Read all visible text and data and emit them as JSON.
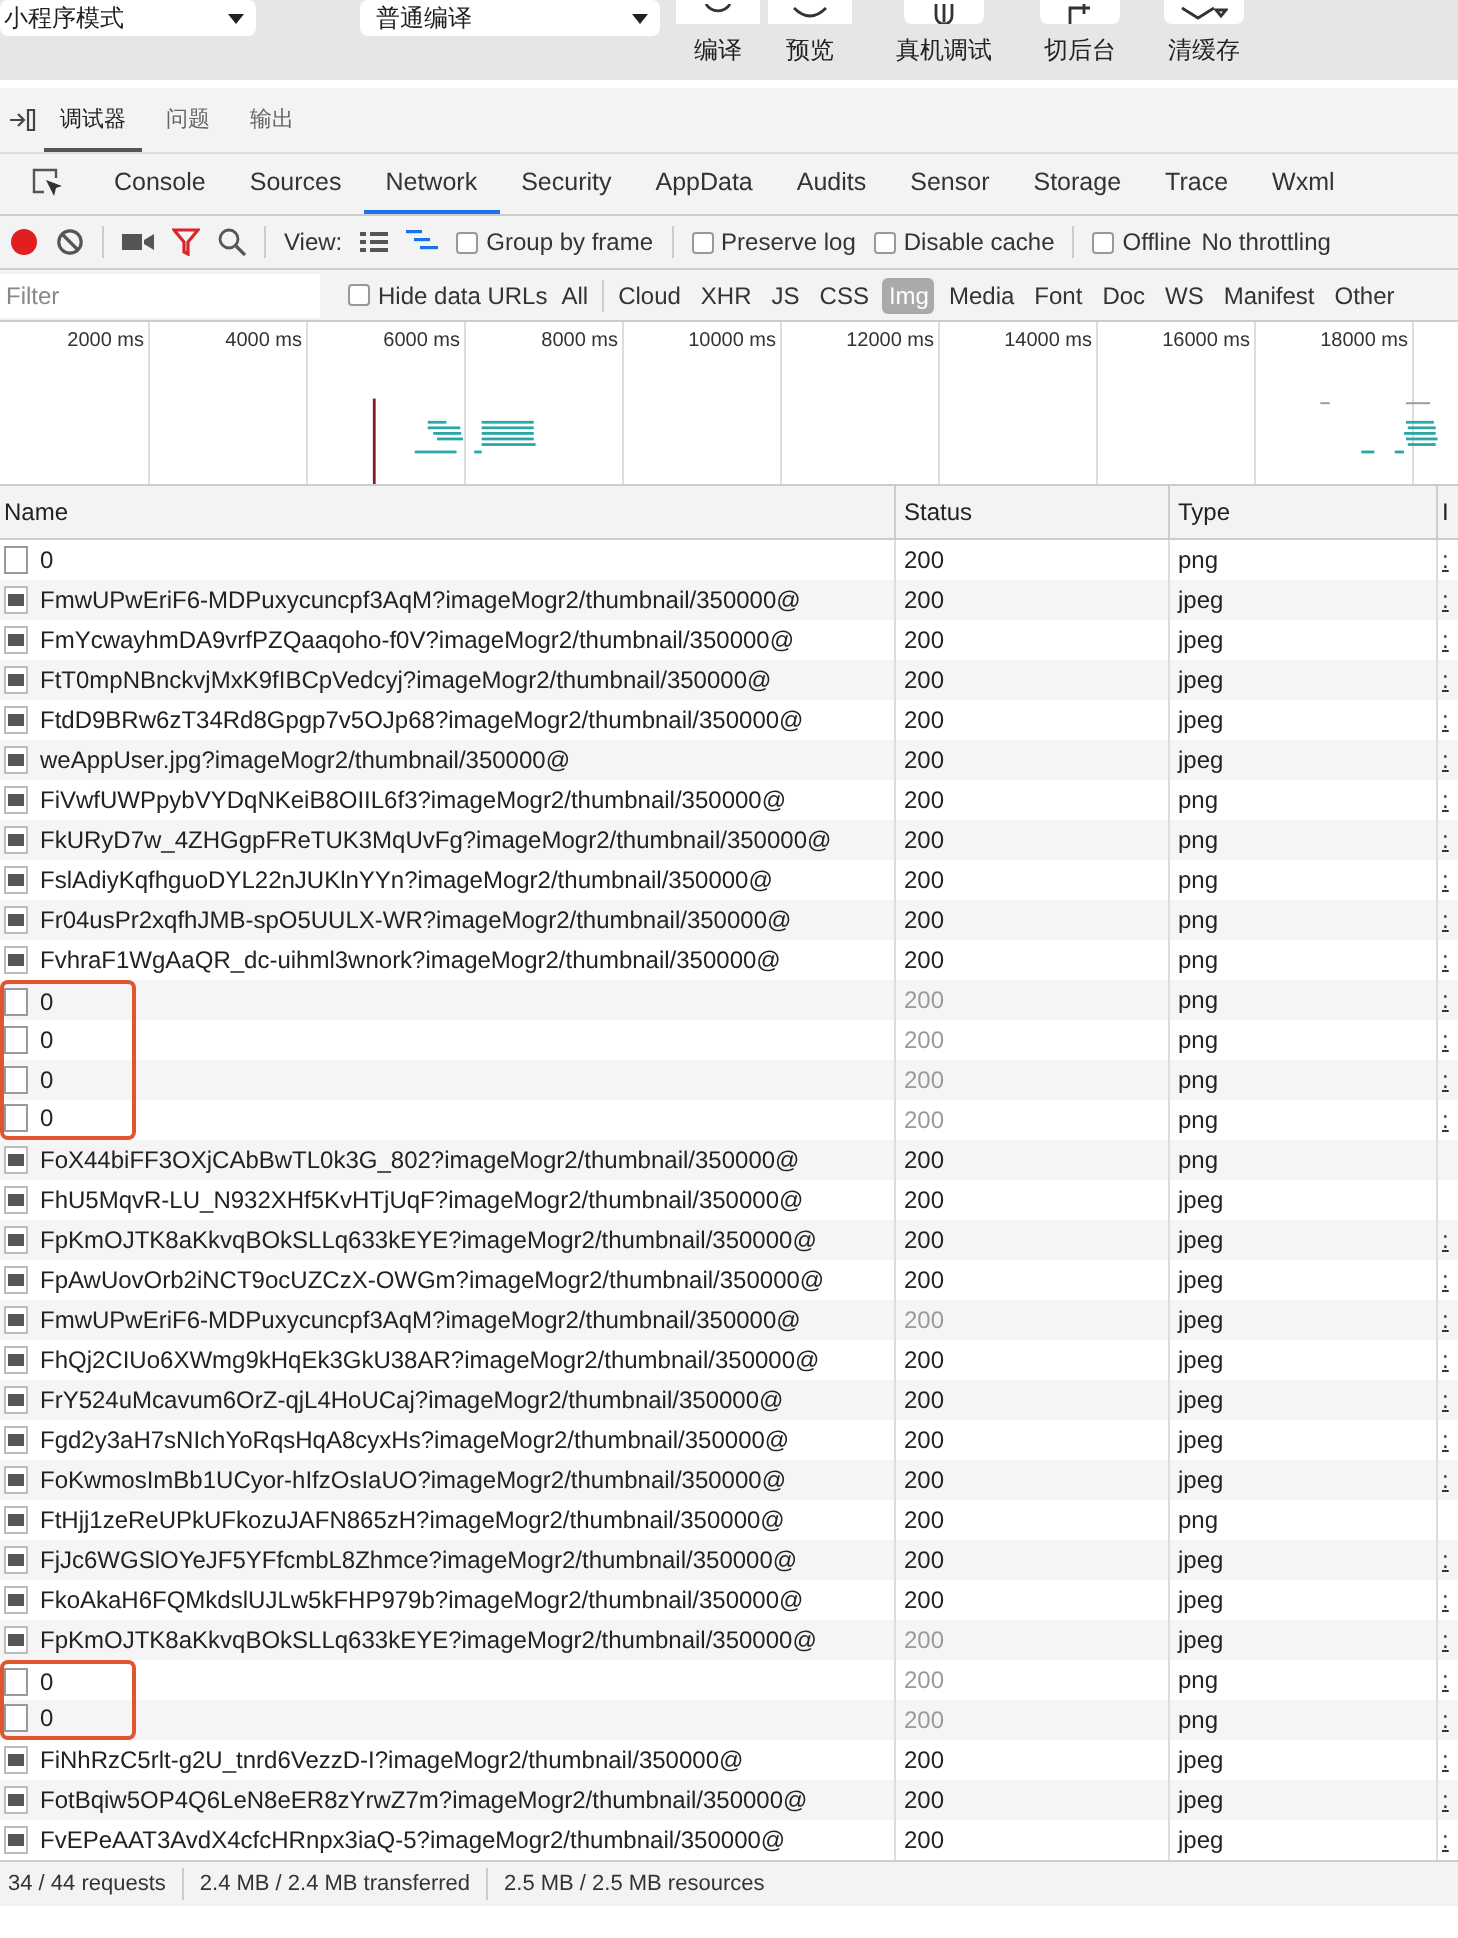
{
  "top_toolbar": {
    "mode_dropdown": "小程序模式",
    "compile_dropdown": "普通编译",
    "buttons": [
      {
        "label": "编译",
        "kind": "refresh"
      },
      {
        "label": "预览",
        "kind": "eye"
      },
      {
        "label": "真机调试",
        "kind": "bug"
      },
      {
        "label": "切后台",
        "kind": "switch"
      },
      {
        "label": "清缓存",
        "kind": "layers"
      }
    ]
  },
  "panel_tabs": [
    {
      "label": "调试器",
      "selected": true
    },
    {
      "label": "问题",
      "selected": false
    },
    {
      "label": "输出",
      "selected": false
    }
  ],
  "devtools_tabs": [
    {
      "label": "Console",
      "selected": false
    },
    {
      "label": "Sources",
      "selected": false
    },
    {
      "label": "Network",
      "selected": true
    },
    {
      "label": "Security",
      "selected": false
    },
    {
      "label": "AppData",
      "selected": false
    },
    {
      "label": "Audits",
      "selected": false
    },
    {
      "label": "Sensor",
      "selected": false
    },
    {
      "label": "Storage",
      "selected": false
    },
    {
      "label": "Trace",
      "selected": false
    },
    {
      "label": "Wxml",
      "selected": false
    }
  ],
  "network_toolbar": {
    "recording": true,
    "filter_active": true,
    "view_label": "View:",
    "large_rows": false,
    "waterfall_view": true,
    "checkboxes": [
      {
        "label": "Group by frame",
        "checked": false
      },
      {
        "label": "Preserve log",
        "checked": false
      },
      {
        "label": "Disable cache",
        "checked": false
      },
      {
        "label": "Offline",
        "checked": false
      }
    ],
    "throttling": "No throttling"
  },
  "filter_bar": {
    "placeholder": "Filter",
    "hide_data_urls": {
      "label": "Hide data URLs",
      "checked": false
    },
    "types": [
      {
        "label": "All",
        "selected": false
      },
      {
        "label": "Cloud",
        "selected": false
      },
      {
        "label": "XHR",
        "selected": false
      },
      {
        "label": "JS",
        "selected": false
      },
      {
        "label": "CSS",
        "selected": false
      },
      {
        "label": "Img",
        "selected": true
      },
      {
        "label": "Media",
        "selected": false
      },
      {
        "label": "Font",
        "selected": false
      },
      {
        "label": "Doc",
        "selected": false
      },
      {
        "label": "WS",
        "selected": false
      },
      {
        "label": "Manifest",
        "selected": false
      },
      {
        "label": "Other",
        "selected": false
      }
    ]
  },
  "timeline": {
    "ticks": [
      "2000 ms",
      "4000 ms",
      "6000 ms",
      "8000 ms",
      "10000 ms",
      "12000 ms",
      "14000 ms",
      "16000 ms",
      "18000 ms"
    ]
  },
  "table": {
    "columns": [
      "Name",
      "Status",
      "Type",
      "I"
    ],
    "rows": [
      {
        "name": "0",
        "status": "200",
        "type": "png",
        "column_4": ":",
        "kind": "blank",
        "dimmed": false,
        "highlighted": false
      },
      {
        "name": "FmwUPwEriF6-MDPuxycuncpf3AqM?imageMogr2/thumbnail/350000@",
        "status": "200",
        "type": "jpeg",
        "column_4": ":",
        "kind": "image",
        "dimmed": false,
        "highlighted": false
      },
      {
        "name": "FmYcwayhmDA9vrfPZQaaqoho-f0V?imageMogr2/thumbnail/350000@",
        "status": "200",
        "type": "jpeg",
        "column_4": ":",
        "kind": "image",
        "dimmed": false,
        "highlighted": false
      },
      {
        "name": "FtT0mpNBnckvjMxK9fIBCpVedcyj?imageMogr2/thumbnail/350000@",
        "status": "200",
        "type": "jpeg",
        "column_4": ":",
        "kind": "image",
        "dimmed": false,
        "highlighted": false
      },
      {
        "name": "FtdD9BRw6zT34Rd8Gpgp7v5OJp68?imageMogr2/thumbnail/350000@",
        "status": "200",
        "type": "jpeg",
        "column_4": ":",
        "kind": "image",
        "dimmed": false,
        "highlighted": false
      },
      {
        "name": "weAppUser.jpg?imageMogr2/thumbnail/350000@",
        "status": "200",
        "type": "jpeg",
        "column_4": ":",
        "kind": "image",
        "dimmed": false,
        "highlighted": false
      },
      {
        "name": "FiVwfUWPpybVYDqNKeiB8OIIL6f3?imageMogr2/thumbnail/350000@",
        "status": "200",
        "type": "png",
        "column_4": ":",
        "kind": "image",
        "dimmed": false,
        "highlighted": false
      },
      {
        "name": "FkURyD7w_4ZHGgpFReTUK3MqUvFg?imageMogr2/thumbnail/350000@",
        "status": "200",
        "type": "png",
        "column_4": ":",
        "kind": "image",
        "dimmed": false,
        "highlighted": false
      },
      {
        "name": "FslAdiyKqfhguoDYL22nJUKlnYYn?imageMogr2/thumbnail/350000@",
        "status": "200",
        "type": "png",
        "column_4": ":",
        "kind": "image",
        "dimmed": false,
        "highlighted": false
      },
      {
        "name": "Fr04usPr2xqfhJMB-spO5UULX-WR?imageMogr2/thumbnail/350000@",
        "status": "200",
        "type": "png",
        "column_4": ":",
        "kind": "image",
        "dimmed": false,
        "highlighted": false
      },
      {
        "name": "FvhraF1WgAaQR_dc-uihml3wnork?imageMogr2/thumbnail/350000@",
        "status": "200",
        "type": "png",
        "column_4": ":",
        "kind": "image",
        "dimmed": false,
        "highlighted": false
      },
      {
        "name": "0",
        "status": "200",
        "type": "png",
        "column_4": ":",
        "kind": "blank",
        "dimmed": true,
        "highlighted": true
      },
      {
        "name": "0",
        "status": "200",
        "type": "png",
        "column_4": ":",
        "kind": "blank",
        "dimmed": true,
        "highlighted": true
      },
      {
        "name": "0",
        "status": "200",
        "type": "png",
        "column_4": ":",
        "kind": "blank",
        "dimmed": true,
        "highlighted": true
      },
      {
        "name": "0",
        "status": "200",
        "type": "png",
        "column_4": ":",
        "kind": "blank",
        "dimmed": true,
        "highlighted": true
      },
      {
        "name": "FoX44biFF3OXjCAbBwTL0k3G_802?imageMogr2/thumbnail/350000@",
        "status": "200",
        "type": "png",
        "kind": "image",
        "dimmed": false,
        "highlighted": false
      },
      {
        "name": "FhU5MqvR-LU_N932XHf5KvHTjUqF?imageMogr2/thumbnail/350000@",
        "status": "200",
        "type": "jpeg",
        "kind": "image",
        "dimmed": false,
        "highlighted": false
      },
      {
        "name": "FpKmOJTK8aKkvqBOkSLLq633kEYE?imageMogr2/thumbnail/350000@",
        "status": "200",
        "type": "jpeg",
        "column_4": ":",
        "kind": "image",
        "dimmed": false,
        "highlighted": false
      },
      {
        "name": "FpAwUovOrb2iNCT9ocUZCzX-OWGm?imageMogr2/thumbnail/350000@",
        "status": "200",
        "type": "jpeg",
        "column_4": ":",
        "kind": "image",
        "dimmed": false,
        "highlighted": false
      },
      {
        "name": "FmwUPwEriF6-MDPuxycuncpf3AqM?imageMogr2/thumbnail/350000@",
        "status": "200",
        "type": "jpeg",
        "column_4": ":",
        "kind": "image",
        "dimmed": true,
        "highlighted": false
      },
      {
        "name": "FhQj2CIUo6XWmg9kHqEk3GkU38AR?imageMogr2/thumbnail/350000@",
        "status": "200",
        "type": "jpeg",
        "column_4": ":",
        "kind": "image",
        "dimmed": false,
        "highlighted": false
      },
      {
        "name": "FrY524uMcavum6OrZ-qjL4HoUCaj?imageMogr2/thumbnail/350000@",
        "status": "200",
        "type": "jpeg",
        "column_4": ":",
        "kind": "image",
        "dimmed": false,
        "highlighted": false
      },
      {
        "name": "Fgd2y3aH7sNIchYoRqsHqA8cyxHs?imageMogr2/thumbnail/350000@",
        "status": "200",
        "type": "jpeg",
        "column_4": ":",
        "kind": "image",
        "dimmed": false,
        "highlighted": false
      },
      {
        "name": "FoKwmosImBb1UCyor-hIfzOsIaUO?imageMogr2/thumbnail/350000@",
        "status": "200",
        "type": "jpeg",
        "column_4": ":",
        "kind": "image",
        "dimmed": false,
        "highlighted": false
      },
      {
        "name": "FtHjj1zeReUPkUFkozuJAFN865zH?imageMogr2/thumbnail/350000@",
        "status": "200",
        "type": "png",
        "kind": "image",
        "dimmed": false,
        "highlighted": false
      },
      {
        "name": "FjJc6WGSlOYeJF5YFfcmbL8Zhmce?imageMogr2/thumbnail/350000@",
        "status": "200",
        "type": "jpeg",
        "column_4": ":",
        "kind": "image",
        "dimmed": false,
        "highlighted": false
      },
      {
        "name": "FkoAkaH6FQMkdslUJLw5kFHP979b?imageMogr2/thumbnail/350000@",
        "status": "200",
        "type": "jpeg",
        "column_4": ":",
        "kind": "image",
        "dimmed": false,
        "highlighted": false
      },
      {
        "name": "FpKmOJTK8aKkvqBOkSLLq633kEYE?imageMogr2/thumbnail/350000@",
        "status": "200",
        "type": "jpeg",
        "column_4": ":",
        "kind": "image",
        "dimmed": true,
        "highlighted": false
      },
      {
        "name": "0",
        "status": "200",
        "type": "png",
        "column_4": ":",
        "kind": "blank",
        "dimmed": true,
        "highlighted": true
      },
      {
        "name": "0",
        "status": "200",
        "type": "png",
        "column_4": ":",
        "kind": "blank",
        "dimmed": true,
        "highlighted": true
      },
      {
        "name": "FiNhRzC5rlt-g2U_tnrd6VezzD-I?imageMogr2/thumbnail/350000@",
        "status": "200",
        "type": "jpeg",
        "column_4": ":",
        "kind": "image",
        "dimmed": false,
        "highlighted": false
      },
      {
        "name": "FotBqiw5OP4Q6LeN8eER8zYrwZ7m?imageMogr2/thumbnail/350000@",
        "status": "200",
        "type": "jpeg",
        "column_4": ":",
        "kind": "image",
        "dimmed": false,
        "highlighted": false
      },
      {
        "name": "FvEPeAAT3AvdX4cfcHRnpx3iaQ-5?imageMogr2/thumbnail/350000@",
        "status": "200",
        "type": "jpeg",
        "column_4": ":",
        "kind": "image",
        "dimmed": false,
        "highlighted": false
      }
    ]
  },
  "status_bar": [
    "34 / 44 requests",
    "2.4 MB / 2.4 MB transferred",
    "2.5 MB / 2.5 MB resources"
  ]
}
